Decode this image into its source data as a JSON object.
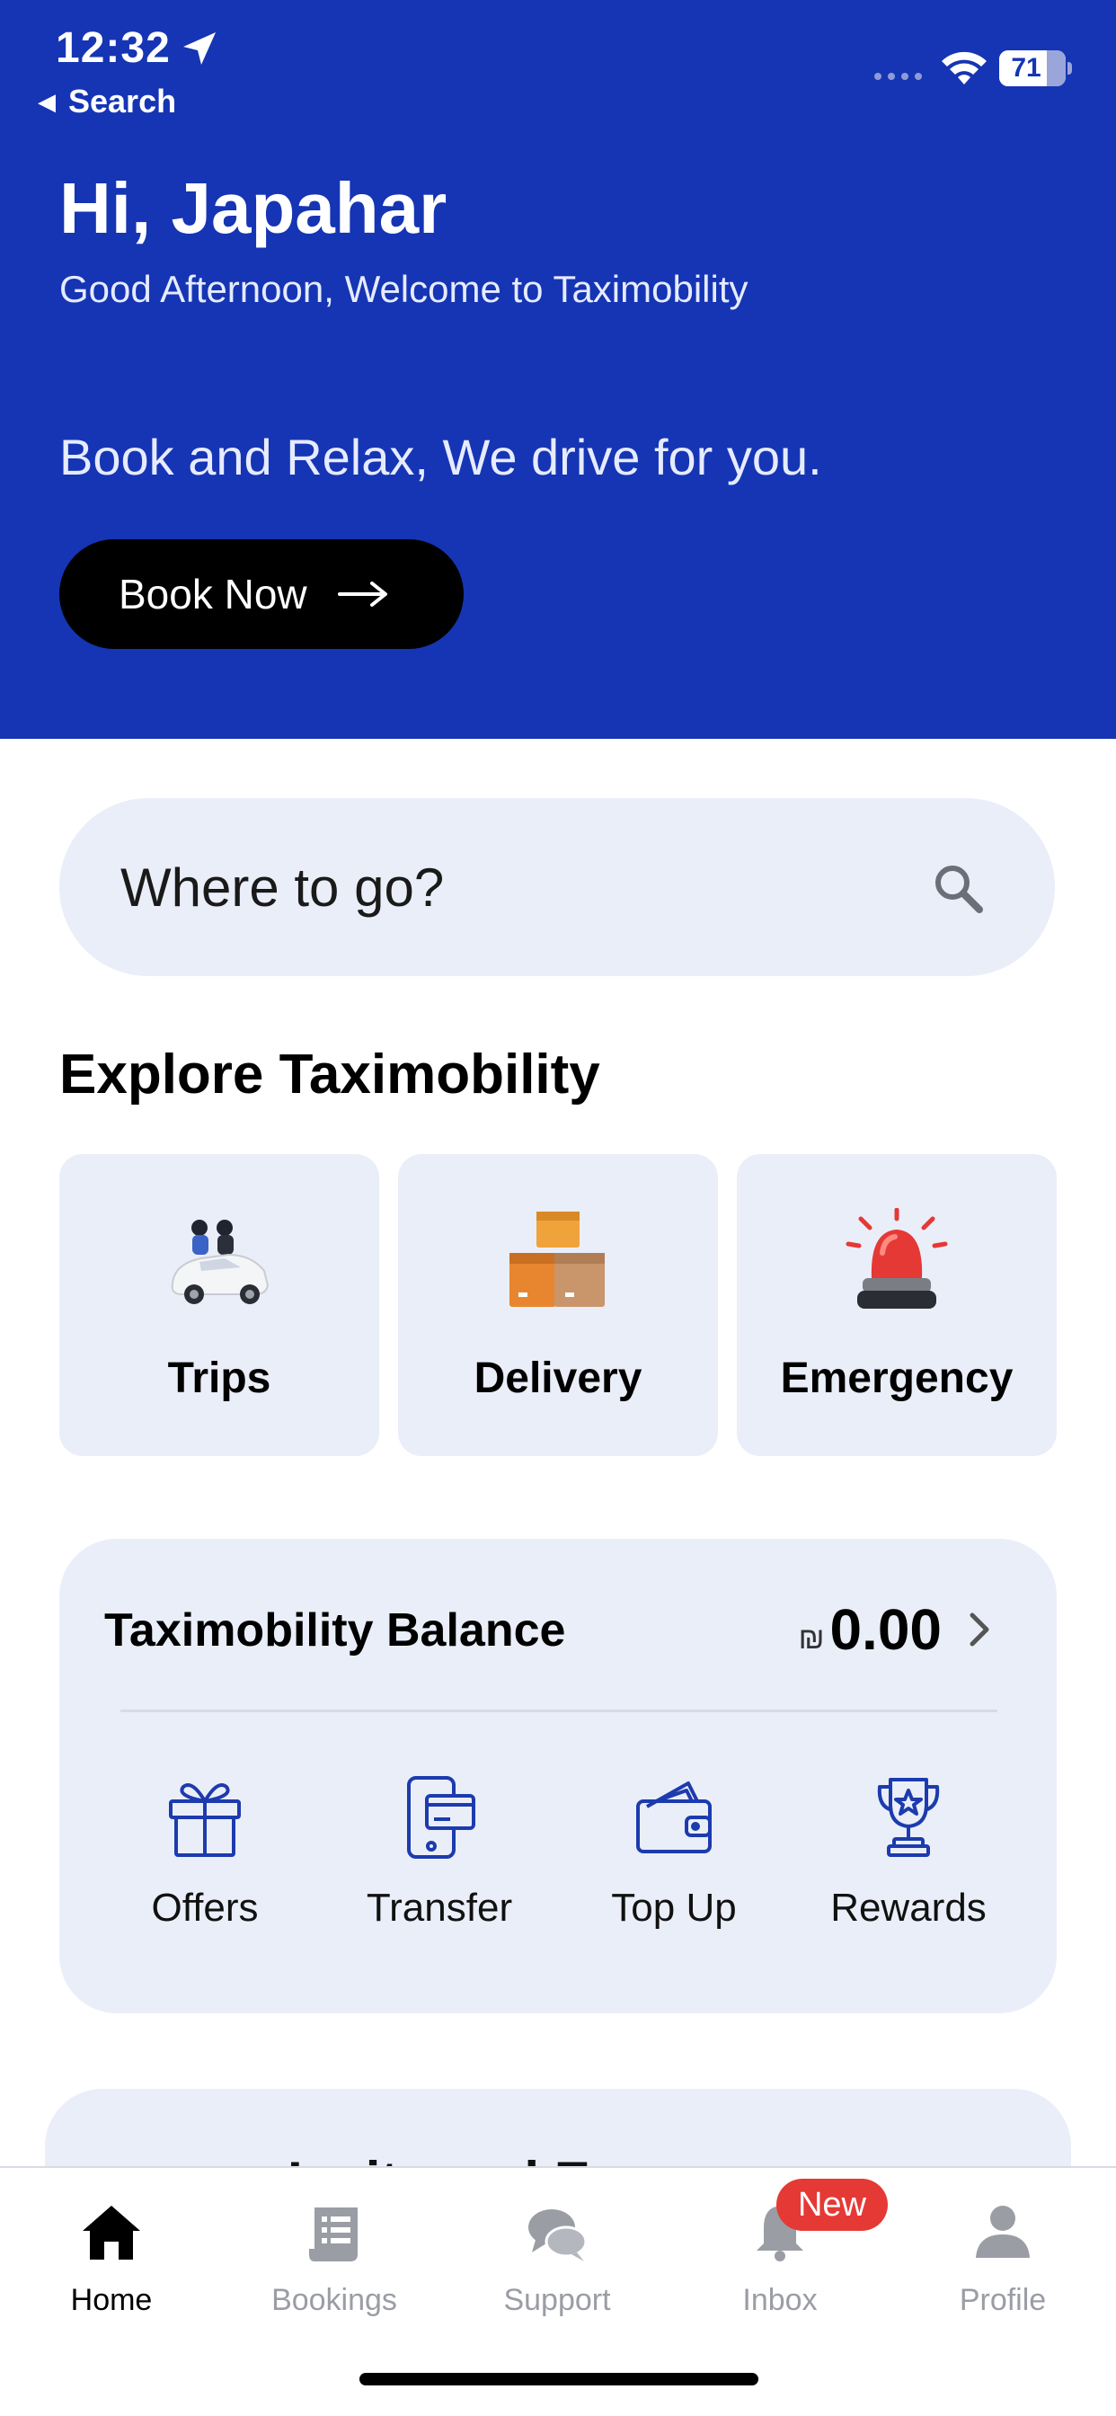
{
  "status_bar": {
    "time": "12:32",
    "back_label": "Search",
    "battery": "71"
  },
  "header": {
    "greeting": "Hi, Japahar",
    "subtitle": "Good Afternoon, Welcome to Taximobility",
    "tagline": "Book and Relax, We drive for you.",
    "cta_label": "Book Now"
  },
  "search": {
    "placeholder": "Where to go?"
  },
  "explore": {
    "title": "Explore Taximobility",
    "tiles": [
      {
        "label": "Trips",
        "icon": "car-with-passengers-icon"
      },
      {
        "label": "Delivery",
        "icon": "boxes-icon"
      },
      {
        "label": "Emergency",
        "icon": "siren-icon"
      }
    ]
  },
  "balance": {
    "title": "Taximobility Balance",
    "currency_symbol": "₪",
    "amount": "0.00",
    "actions": [
      {
        "label": "Offers",
        "icon": "gift-icon"
      },
      {
        "label": "Transfer",
        "icon": "phone-card-icon"
      },
      {
        "label": "Top Up",
        "icon": "wallet-icon"
      },
      {
        "label": "Rewards",
        "icon": "trophy-icon"
      }
    ]
  },
  "next_section": {
    "title_fragment": "...Invite and Earn"
  },
  "tabbar": {
    "tabs": [
      {
        "label": "Home",
        "icon": "home-icon",
        "active": true
      },
      {
        "label": "Bookings",
        "icon": "bookings-icon",
        "active": false
      },
      {
        "label": "Support",
        "icon": "chat-bubbles-icon",
        "active": false
      },
      {
        "label": "Inbox",
        "icon": "bell-icon",
        "active": false
      },
      {
        "label": "Profile",
        "icon": "person-icon",
        "active": false
      }
    ],
    "inbox_badge": "New"
  },
  "colors": {
    "brand_blue": "#1535B4",
    "card_bg": "#EAEEF8",
    "badge_red": "#E53935",
    "icon_blue": "#1C3BAE"
  }
}
